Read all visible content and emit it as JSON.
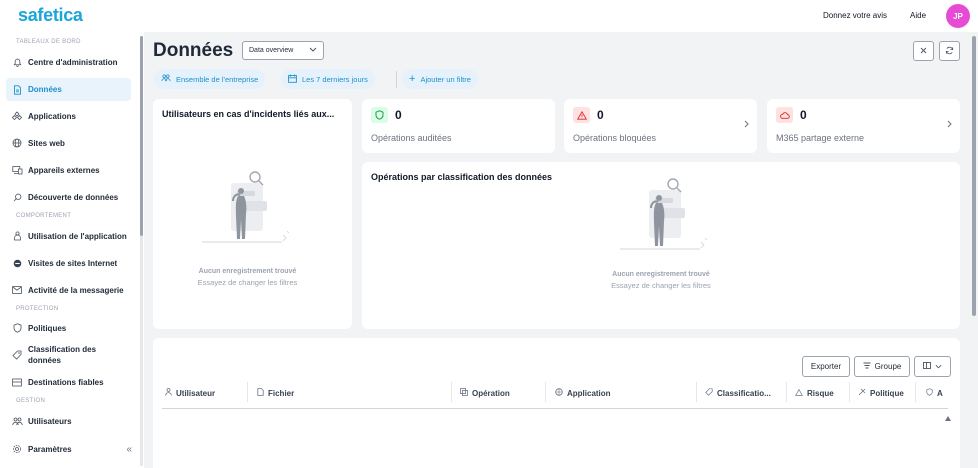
{
  "header": {
    "logo": "safetica",
    "feedback": "Donnez votre avis",
    "help": "Aide",
    "avatar_initials": "JP",
    "avatar_color": "#e84bd3",
    "brand_color": "#1aa6d8"
  },
  "sidebar": {
    "section_dashboards": "TABLEAUX DE BORD",
    "section_behavior": "COMPORTEMENT",
    "section_protection": "PROTECTION",
    "section_management": "GESTION",
    "items": {
      "admin_center": "Centre d'administration",
      "data": "Données",
      "applications": "Applications",
      "websites": "Sites web",
      "external_devices": "Appareils externes",
      "data_discovery": "Découverte de données",
      "app_usage": "Utilisation de l'application",
      "website_visits": "Visites de sites Internet",
      "mail_activity": "Activité de la messagerie",
      "policies": "Politiques",
      "data_classification": "Classification des données",
      "trusted_destinations": "Destinations fiables",
      "users": "Utilisateurs",
      "settings": "Paramètres"
    },
    "collapse_glyph": "«"
  },
  "main": {
    "title": "Données",
    "view_select": "Data overview",
    "filters": {
      "scope": "Ensemble de l'entreprise",
      "period": "Les 7 derniers jours",
      "add_filter": "Ajouter un filtre"
    },
    "incidents_card": {
      "title": "Utilisateurs en cas d'incidents liés aux...",
      "empty_title": "Aucun enregistrement trouvé",
      "empty_hint": "Essayez de changer les filtres"
    },
    "stats": [
      {
        "icon": "shield-icon",
        "value": "0",
        "label": "Opérations auditées",
        "color": "#16a34a",
        "bg": "#dcfce7"
      },
      {
        "icon": "warning-icon",
        "value": "0",
        "label": "Opérations bloquées",
        "color": "#dc2626",
        "bg": "#fee2e2"
      },
      {
        "icon": "cloud-icon",
        "value": "0",
        "label": "M365 partage externe",
        "color": "#dc2626",
        "bg": "#fee2e2"
      }
    ],
    "classification_card": {
      "title": "Opérations par classification des données",
      "empty_title": "Aucun enregistrement trouvé",
      "empty_hint": "Essayez de changer les filtres"
    },
    "table": {
      "export": "Exporter",
      "group": "Groupe",
      "columns": [
        "Utilisateur",
        "Fichier",
        "Opération",
        "Application",
        "Classificatio...",
        "Risque",
        "Politique",
        "A"
      ]
    }
  }
}
